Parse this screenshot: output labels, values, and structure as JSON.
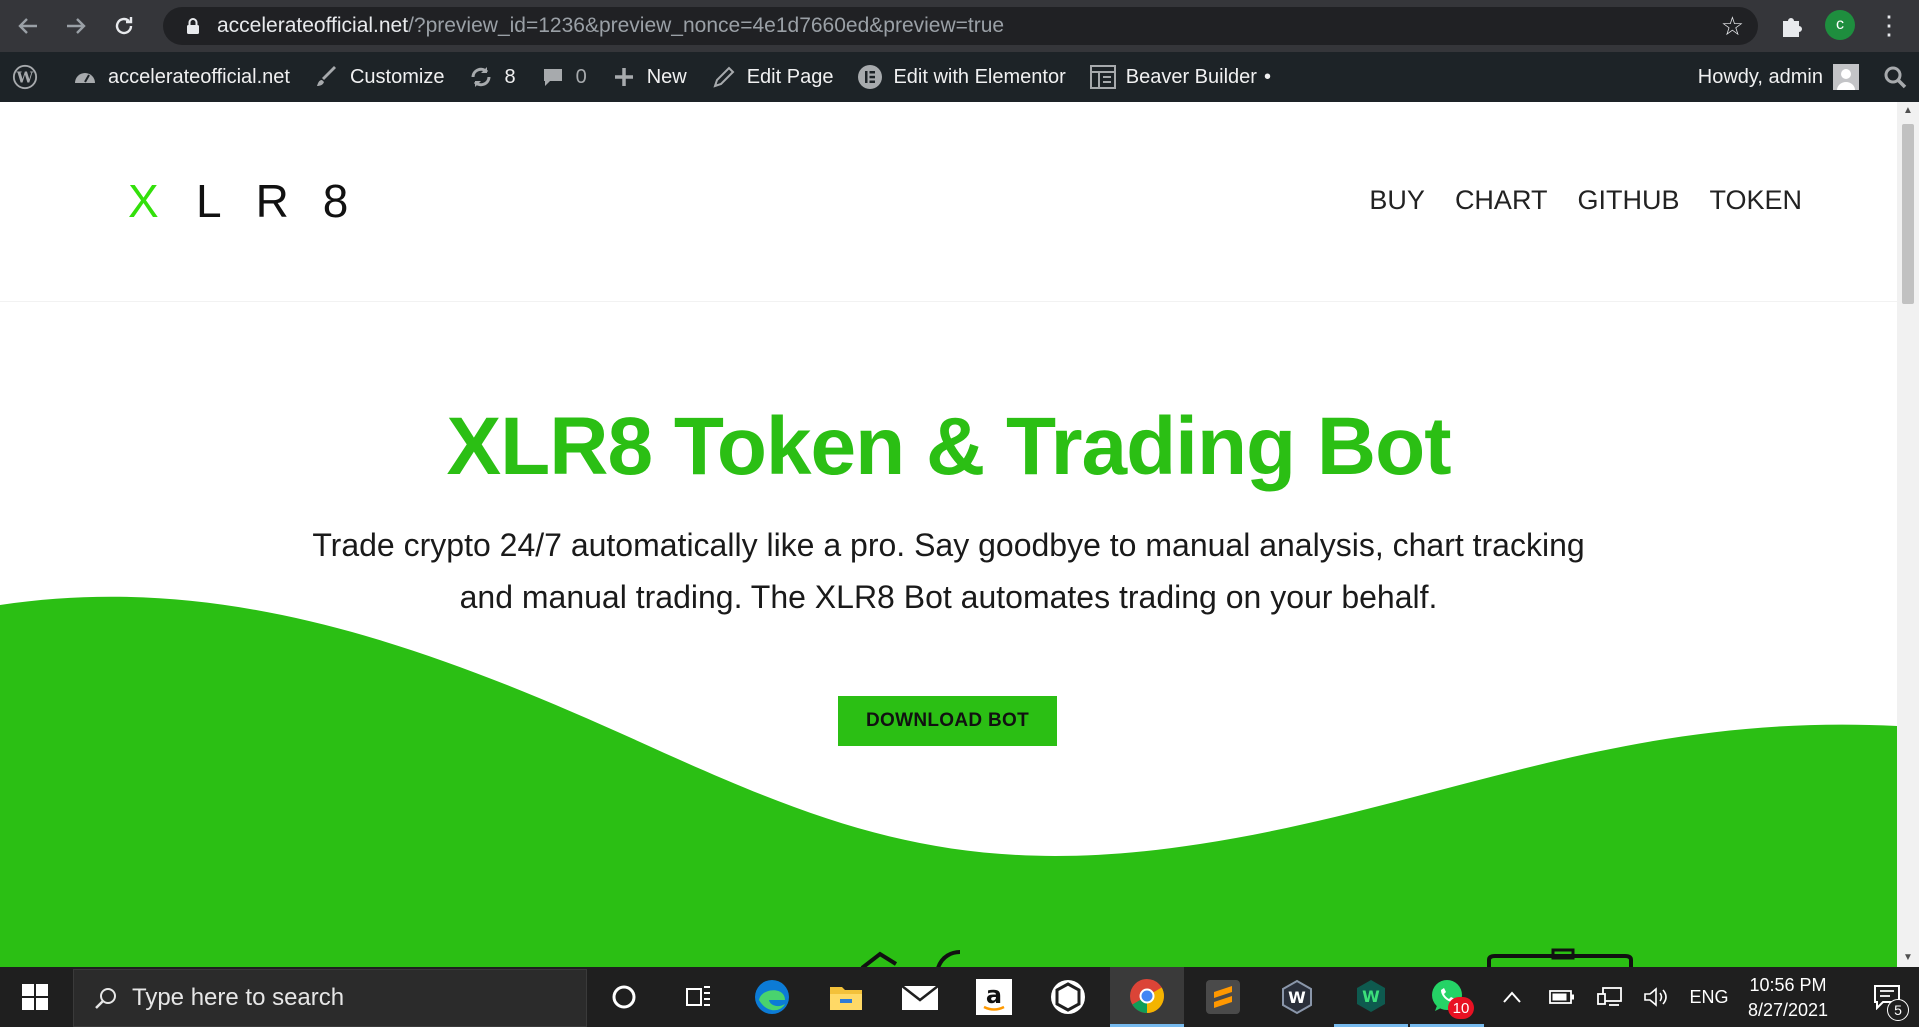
{
  "browser": {
    "url_domain": "accelerateofficial.net",
    "url_path": "/?preview_id=1236&preview_nonce=4e1d7660ed&preview=true",
    "back_icon": "arrow-left-icon",
    "forward_icon": "arrow-right-icon",
    "reload_icon": "reload-icon",
    "profile_initial": "c"
  },
  "admin_bar": {
    "site_name": "accelerateofficial.net",
    "customize": "Customize",
    "updates_count": "8",
    "comments_count": "0",
    "new": "New",
    "edit_page": "Edit Page",
    "edit_elementor": "Edit with Elementor",
    "beaver_builder": "Beaver Builder",
    "beaver_dot": "•",
    "howdy": "Howdy, admin"
  },
  "site": {
    "logo_x": "X",
    "logo_rest": "LR8",
    "nav": [
      "BUY",
      "CHART",
      "GITHUB",
      "TOKEN"
    ],
    "hero_title": "XLR8 Token & Trading Bot",
    "hero_subtitle_line1": "Trade crypto 24/7 automatically like a pro. Say goodbye to manual analysis, chart tracking",
    "hero_subtitle_line2": "and manual trading. The XLR8 Bot automates trading on your behalf.",
    "cta_label": "DOWNLOAD BOT",
    "accent_color": "#2bbf14"
  },
  "taskbar": {
    "search_placeholder": "Type here to search",
    "whatsapp_badge": "10",
    "language": "ENG",
    "time": "10:56 PM",
    "date": "8/27/2021",
    "notification_count": "5"
  }
}
